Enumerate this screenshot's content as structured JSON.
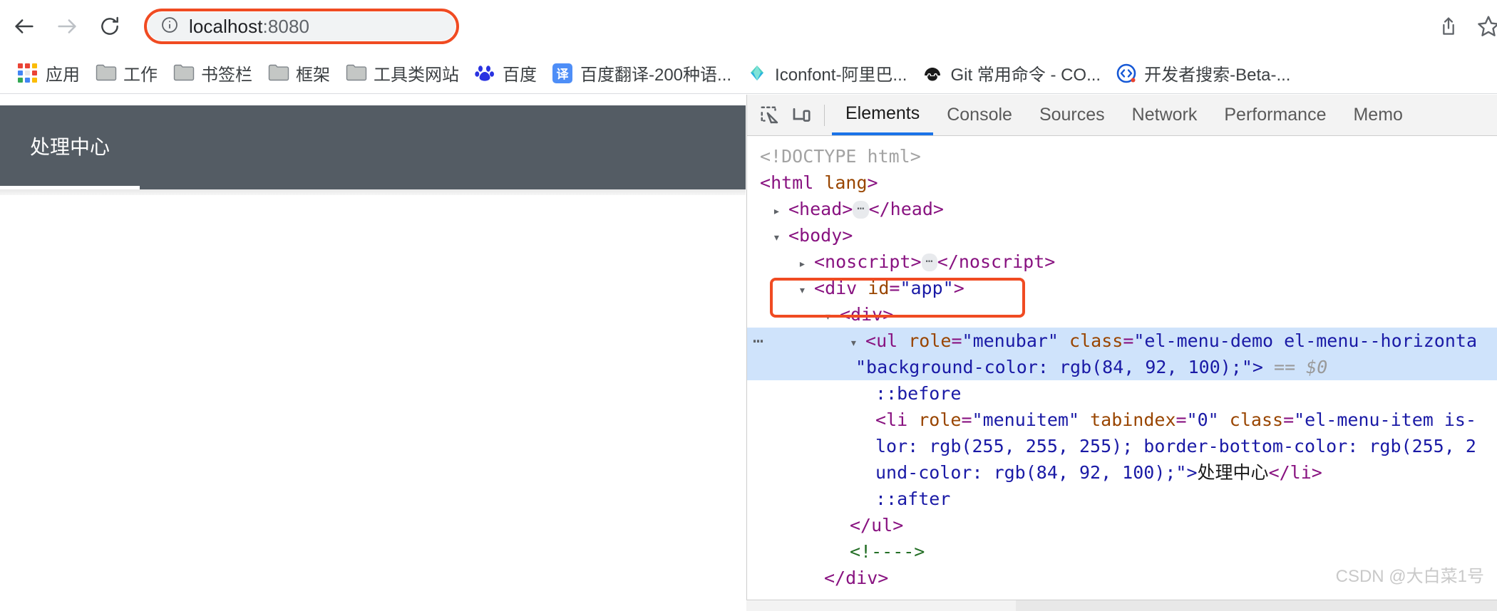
{
  "browser": {
    "back_icon": "arrow-left-icon",
    "forward_icon": "arrow-right-icon",
    "reload_icon": "reload-icon",
    "omnibox": {
      "info_icon": "info-circle-icon",
      "host": "localhost",
      "port": ":8080",
      "full_url": "localhost:8080",
      "highlight_color": "#f04b22"
    },
    "right_icons": [
      {
        "name": "share-icon",
        "label": "Share"
      },
      {
        "name": "bookmark-star-icon",
        "label": "Bookmark this tab"
      }
    ]
  },
  "bookmarks": [
    {
      "label": "应用",
      "icon": "apps-grid-icon"
    },
    {
      "label": "工作",
      "icon": "folder-icon"
    },
    {
      "label": "书签栏",
      "icon": "folder-icon"
    },
    {
      "label": "框架",
      "icon": "folder-icon"
    },
    {
      "label": "工具类网站",
      "icon": "folder-icon"
    },
    {
      "label": "百度",
      "icon": "baidu-paw-icon"
    },
    {
      "label": "百度翻译-200种语...",
      "icon": "baidu-translate-icon",
      "icon_text": "译"
    },
    {
      "label": "Iconfont-阿里巴...",
      "icon": "iconfont-icon"
    },
    {
      "label": "Git 常用命令 - CO...",
      "icon": "csdn-icon"
    },
    {
      "label": "开发者搜索-Beta-...",
      "icon": "dev-search-icon"
    }
  ],
  "page": {
    "menubar_background": "#545c64",
    "menu_items": [
      {
        "label": "处理中心",
        "active": true,
        "color": "#ffffff",
        "border_bottom_color": "#ffffff"
      }
    ]
  },
  "devtools": {
    "toolbar_icons": [
      {
        "name": "inspect-element-icon"
      },
      {
        "name": "device-toolbar-icon"
      }
    ],
    "tabs": [
      {
        "label": "Elements",
        "active": true
      },
      {
        "label": "Console",
        "active": false
      },
      {
        "label": "Sources",
        "active": false
      },
      {
        "label": "Network",
        "active": false
      },
      {
        "label": "Performance",
        "active": false
      },
      {
        "label": "Memo",
        "active": false
      }
    ],
    "active_tab_underline": "#1a73e8",
    "selected_row_background": "#cfe3fb",
    "dom": {
      "l1_doctype": "<!DOCTYPE html>",
      "l2_html_tag": "html",
      "l2_html_attr": " lang",
      "l3_head_open": "<head>",
      "l3_head_close": "</head>",
      "l4_body": "<body>",
      "l5_noscript_open": "<noscript>",
      "l5_noscript_close": "</noscript>",
      "l6_div_app": "<div id=\"app\">",
      "l6_div_app_tag": "div",
      "l6_div_app_attr": "id",
      "l6_div_app_val": "\"app\"",
      "l7_div": "<div>",
      "l8_ul_open": "<ul role=\"menubar\" class=\"el-menu-demo el-menu--horizonta",
      "l8_ul_tag": "ul",
      "l8_ul_attr_role": "role",
      "l8_ul_val_role": "\"menubar\"",
      "l8_ul_attr_class": "class",
      "l8_ul_val_class": "\"el-menu-demo el-menu--horizonta",
      "l9_ul_style": "\"background-color: rgb(84, 92, 100);\">",
      "l9_equals": "==",
      "l9_dollar": "$0",
      "l10_before": "::before",
      "l11_li": "<li role=\"menuitem\" tabindex=\"0\" class=\"el-menu-item is-",
      "l11_li_tag": "li",
      "l11_attr_role": "role",
      "l11_val_role": "\"menuitem\"",
      "l11_attr_tabindex": "tabindex",
      "l11_val_tabindex": "\"0\"",
      "l11_attr_class": "class",
      "l11_val_class": "\"el-menu-item is-",
      "l12_style": "lor: rgb(255, 255, 255); border-bottom-color: rgb(255, 2",
      "l13_style": "und-color: rgb(84, 92, 100);\">",
      "l13_text": "处理中心",
      "l13_close": "</li>",
      "l14_after": "::after",
      "l15_ul_close": "</ul>",
      "l16_comment": "<!---->",
      "l17_div_close": "</div>"
    },
    "annotations": [
      {
        "name": "div-app-highlight",
        "color": "#f04b22"
      }
    ]
  },
  "watermark": "CSDN @大白菜1号"
}
